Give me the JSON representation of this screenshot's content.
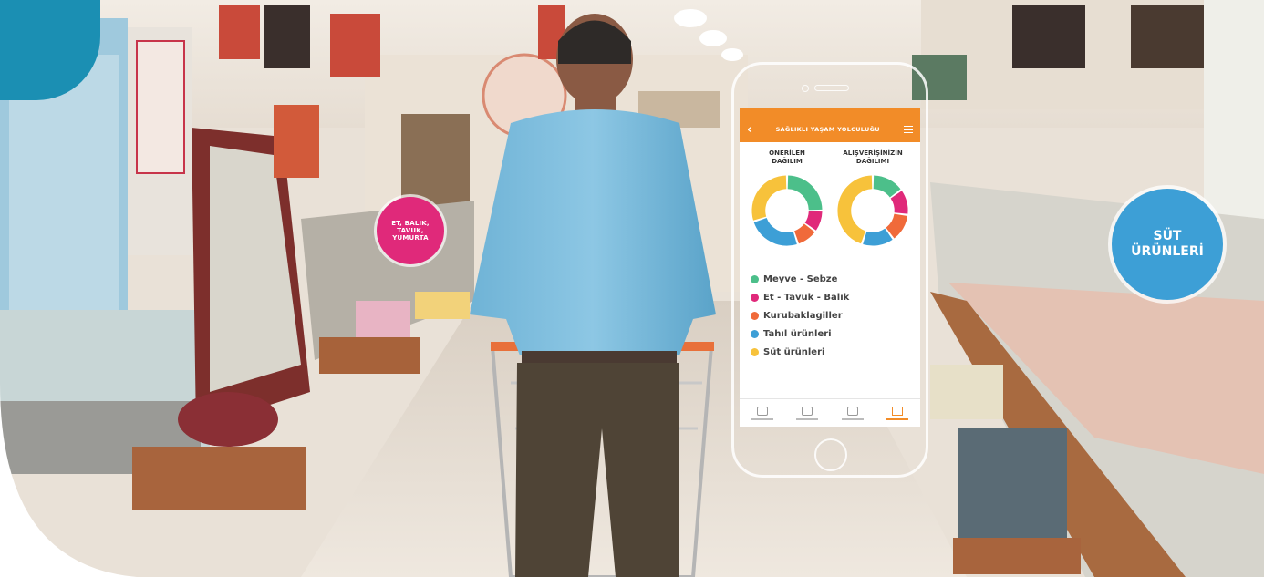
{
  "bubbles": {
    "meat": "ET, BALIK,\nTAVUK,\nYUMURTA",
    "dairy": "SÜT\nÜRÜNLERİ"
  },
  "app": {
    "title": "SAĞLIKLI YAŞAM YOLCULUĞU",
    "back_icon": "chevron-left-icon",
    "menu_icon": "hamburger-menu-icon",
    "chart_recommended_title": "ÖNERİLEN\nDAĞILIM",
    "chart_shopping_title": "ALIŞVERİŞİNİZİN\nDAĞILIMI",
    "legend": [
      {
        "label": "Meyve - Sebze",
        "color": "#4cbf8a"
      },
      {
        "label": "Et - Tavuk - Balık",
        "color": "#e0297a"
      },
      {
        "label": "Kurubaklagiller",
        "color": "#f06a3a"
      },
      {
        "label": "Tahıl ürünleri",
        "color": "#3d9fd6"
      },
      {
        "label": "Süt ürünleri",
        "color": "#f7c23b"
      }
    ],
    "accent": "#f28c28"
  },
  "chart_data": [
    {
      "type": "pie",
      "categories": [
        "Meyve - Sebze",
        "Et - Tavuk - Balık",
        "Kurubaklagiller",
        "Tahıl ürünleri",
        "Süt ürünleri"
      ],
      "values": [
        25,
        10,
        10,
        25,
        30
      ]
    },
    {
      "type": "pie",
      "categories": [
        "Meyve - Sebze",
        "Et - Tavuk - Balık",
        "Kurubaklagiller",
        "Tahıl ürünleri",
        "Süt ürünleri"
      ],
      "values": [
        15,
        12,
        13,
        15,
        45
      ]
    }
  ]
}
